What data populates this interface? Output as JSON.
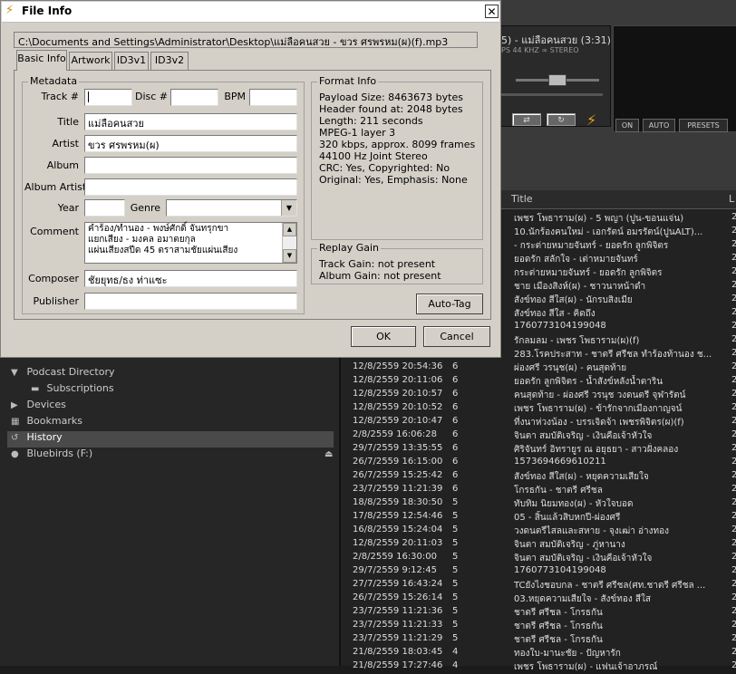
{
  "dialog": {
    "title": "File Info",
    "close_glyph": "✕",
    "path": "C:\\Documents and Settings\\Administrator\\Desktop\\แม่ลือคนสวย - ขวร ศรพรหม(ผ)(f).mp3",
    "tabs": [
      {
        "label": "Basic Info",
        "active": true
      },
      {
        "label": "Artwork",
        "active": false
      },
      {
        "label": "ID3v1",
        "active": false
      },
      {
        "label": "ID3v2",
        "active": false
      }
    ],
    "metadata": {
      "group_label": "Metadata",
      "track_label": "Track #",
      "track_value": "",
      "disc_label": "Disc #",
      "disc_value": "",
      "bpm_label": "BPM",
      "bpm_value": "",
      "title_label": "Title",
      "title_value": "แม่ลือคนสวย",
      "artist_label": "Artist",
      "artist_value": "ขวร ศรพรหม(ผ)",
      "album_label": "Album",
      "album_value": "",
      "album_artist_label": "Album Artist",
      "album_artist_value": "",
      "year_label": "Year",
      "year_value": "",
      "genre_label": "Genre",
      "genre_value": "",
      "comment_label": "Comment",
      "comment_lines": [
        "คำร้อง/ทำนอง - พงษ์ศักดิ์ จันทรุกขา",
        "แยกเสียง - มงคล อมาตยกุล",
        "แผ่นเสียงสปีด 45 ตราสามชัยแผ่นเสียง"
      ],
      "composer_label": "Composer",
      "composer_value": "ชัยยุทธ/ธง ท่าแซะ",
      "publisher_label": "Publisher",
      "publisher_value": ""
    },
    "format_info": {
      "group_label": "Format Info",
      "lines": [
        "Payload Size: 8463673 bytes",
        "Header found at: 2048 bytes",
        "Length: 211 seconds",
        "MPEG-1 layer 3",
        "320 kbps, approx. 8099 frames",
        "44100 Hz Joint Stereo",
        "CRC: Yes, Copyrighted: No",
        "Original: Yes, Emphasis: None"
      ]
    },
    "replay_gain": {
      "group_label": "Replay Gain",
      "track_gain": "Track Gain: not present",
      "album_gain": "Album Gain: not present"
    },
    "autotag_label": "Auto-Tag",
    "ok_label": "OK",
    "cancel_label": "Cancel"
  },
  "player": {
    "now_playing": "5) - แม่ลือคนสวย (3:31)",
    "format": "PS   44 KHZ   ∞ STEREO",
    "eq_on": "ON",
    "eq_auto": "AUTO",
    "eq_presets": "PRESETS",
    "column_title": "Title",
    "column_l": "L"
  },
  "sidebar": {
    "items": [
      {
        "label": "Podcast Directory",
        "icon": "▼"
      },
      {
        "label": "Subscriptions",
        "icon": "▬"
      },
      {
        "label": "Devices",
        "icon": "▶"
      },
      {
        "label": "Bookmarks",
        "icon": "▦"
      },
      {
        "label": "History",
        "icon": "↺"
      },
      {
        "label": "Bluebirds (F:)",
        "icon": "●"
      }
    ],
    "eject_glyph": "⏏"
  },
  "tracks": [
    {
      "d": "",
      "r": "",
      "t": "เพชร โพธาราม(ผ) - 5 พญา (ปูน-ขอนแจ่น)",
      "e": "2"
    },
    {
      "d": "",
      "r": "",
      "t": "10.นักร้องคนใหม่ - เอกรัตน์ อมรรัตน์(ปูนALT)...",
      "e": "2"
    },
    {
      "d": "",
      "r": "",
      "t": "- กระต่ายหมายจันทร์ - ยอดรัก ลูกพิจิตร",
      "e": "2"
    },
    {
      "d": "",
      "r": "",
      "t": "ยอดรัก สลักใจ - เต่าหมายจันทร์",
      "e": "2"
    },
    {
      "d": "",
      "r": "",
      "t": "กระต่ายหมายจันทร์ - ยอดรัก ลูกพิจิตร",
      "e": "2"
    },
    {
      "d": "",
      "r": "",
      "t": "ชาย เมืองสิงห์(ผ) - ชาวนาหน้าดำ",
      "e": "2"
    },
    {
      "d": "",
      "r": "",
      "t": "สังข์ทอง สีใส(ผ) - นักรบสิงเมีย",
      "e": "2"
    },
    {
      "d": "",
      "r": "",
      "t": "สังข์ทอง สีใส - คิดถึง",
      "e": "2"
    },
    {
      "d": "",
      "r": "",
      "t": "1760773104199048",
      "e": "2"
    },
    {
      "d": "",
      "r": "",
      "t": "รักลมลม - เพชร โพธาราม(ผ)(f)",
      "e": "2"
    },
    {
      "d": "",
      "r": "",
      "t": "283.โรคประสาท - ชาตรี ศรีชล ทำร้องท้านอง ช...",
      "e": "2"
    },
    {
      "d": "12/8/2559 20:54:36",
      "r": "6",
      "t": "ผ่องศรี วรนุช(ผ) - คนสุดท้าย",
      "e": "2"
    },
    {
      "d": "12/8/2559 20:11:06",
      "r": "6",
      "t": "ยอดรัก ลูกพิจิตร - น้ำสังข์หลังน้ำตาริน",
      "e": "2"
    },
    {
      "d": "12/8/2559 20:10:57",
      "r": "6",
      "t": "คนสุดท้าย - ผ่องศรี วรนุช วงดนตรี จุฬารัตน์",
      "e": "2"
    },
    {
      "d": "12/8/2559 20:10:52",
      "r": "6",
      "t": "เพชร โพธาราม(ผ) - ข้ารักจากเมืองกาญจน์",
      "e": "2"
    },
    {
      "d": "12/8/2559 20:10:47",
      "r": "6",
      "t": "ที่งนาห่วงน้อง - บรรเจิดจ้า เพชรพิจิตร(ผ)(f)",
      "e": "2"
    },
    {
      "d": "2/8/2559 16:06:28",
      "r": "6",
      "t": "จินตา สมบัติเจริญ - เงินคือเจ้าหัวใจ",
      "e": "2"
    },
    {
      "d": "29/7/2559 13:35:55",
      "r": "6",
      "t": "ศิริจันทร์ อิทรายูร ณ อยุธยา - สาวฝั่งคลอง",
      "e": "2"
    },
    {
      "d": "26/7/2559 16:15:00",
      "r": "6",
      "t": "1573694669610211",
      "e": "2"
    },
    {
      "d": "26/7/2559 15:25:42",
      "r": "6",
      "t": "สังข์ทอง สีใส(ผ) - หยุดความเสียใจ",
      "e": "2"
    },
    {
      "d": "23/7/2559 11:21:39",
      "r": "6",
      "t": "โกรธกัน - ชาตรี ศรีชล",
      "e": "2"
    },
    {
      "d": "18/8/2559 18:30:50",
      "r": "5",
      "t": "ทับทิม นิยมทอง(ผ) - หัวใจบอด",
      "e": "2"
    },
    {
      "d": "17/8/2559 12:54:46",
      "r": "5",
      "t": "05 - สิ้นแล้วสิบหกปี-ผ่องศรี",
      "e": "2"
    },
    {
      "d": "16/8/2559 15:24:04",
      "r": "5",
      "t": "วงดนตรีไสลและสหาย - จุงเฒ่า อ่างทอง",
      "e": "2"
    },
    {
      "d": "12/8/2559 20:11:03",
      "r": "5",
      "t": "จินตา สมบัติเจริญ - ภู่หานาง",
      "e": "2"
    },
    {
      "d": "2/8/2559 16:30:00",
      "r": "5",
      "t": "จินตา สมบัติเจริญ - เงินคือเจ้าหัวใจ",
      "e": "2"
    },
    {
      "d": "29/7/2559 9:12:45",
      "r": "5",
      "t": "1760773104199048",
      "e": "2"
    },
    {
      "d": "27/7/2559 16:43:24",
      "r": "5",
      "t": "TCยังไงชอบกล - ชาตรี ศรีชล(ศท.ชาตรี ศรีชล ...",
      "e": "2"
    },
    {
      "d": "26/7/2559 15:26:14",
      "r": "5",
      "t": "03.หยุดความเสียใจ - สังข์ทอง สีใส",
      "e": "2"
    },
    {
      "d": "23/7/2559 11:21:36",
      "r": "5",
      "t": "ชาตรี ศรีชล - โกรธกัน",
      "e": "2"
    },
    {
      "d": "23/7/2559 11:21:33",
      "r": "5",
      "t": "ชาตรี ศรีชล - โกรธกัน",
      "e": "2"
    },
    {
      "d": "23/7/2559 11:21:29",
      "r": "5",
      "t": "ชาตรี ศรีชล - โกรธกัน",
      "e": "2"
    },
    {
      "d": "21/8/2559 18:03:45",
      "r": "4",
      "t": "ทองใบ-มานะชัย - ปัญหารัก",
      "e": "2"
    },
    {
      "d": "21/8/2559 17:27:46",
      "r": "4",
      "t": "เพชร โพธาราม(ผ) - แฟนเจ้าอาภรณ์",
      "e": "2"
    }
  ]
}
